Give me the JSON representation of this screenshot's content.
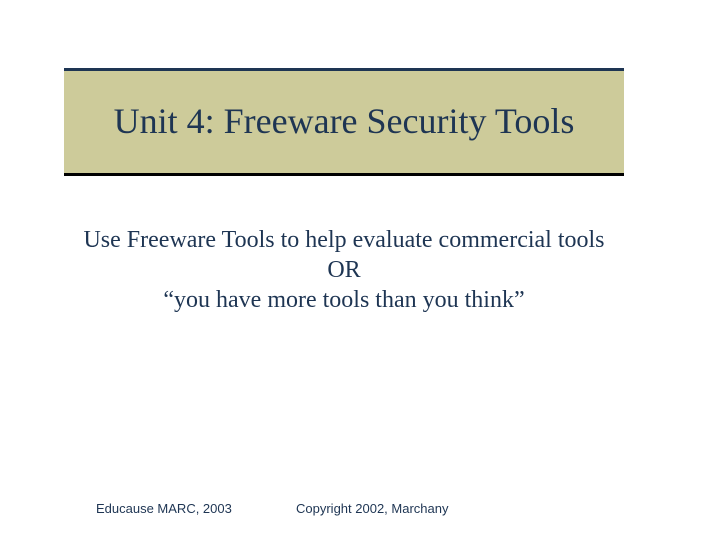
{
  "slide": {
    "title": "Unit 4: Freeware Security Tools",
    "subtitle_line1": "Use Freeware Tools to help evaluate commercial tools OR",
    "subtitle_line2": "“you have more tools than you think”"
  },
  "footer": {
    "left": "Educause MARC, 2003",
    "center": "Copyright 2002, Marchany"
  }
}
